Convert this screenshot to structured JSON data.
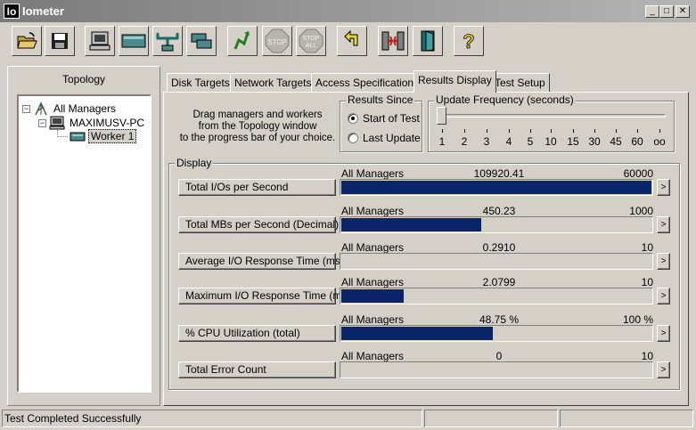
{
  "window": {
    "title": "Iometer",
    "icon_text": "Io",
    "minimize": "_",
    "maximize": "□",
    "close": "✕"
  },
  "toolbar": {
    "buttons": [
      {
        "icon": "open-folder-icon"
      },
      {
        "icon": "save-disk-icon"
      },
      {
        "icon": "new-manager-icon"
      },
      {
        "icon": "new-disk-worker-icon"
      },
      {
        "icon": "new-network-worker-icon"
      },
      {
        "icon": "duplicate-worker-icon"
      },
      {
        "icon": "start-tests-icon"
      },
      {
        "icon": "stop-icon",
        "label": "STOP"
      },
      {
        "icon": "stop-all-icon",
        "label1": "STOP",
        "label2": "ALL"
      },
      {
        "icon": "reset-workers-icon"
      },
      {
        "icon": "disconnect-workers-icon"
      },
      {
        "icon": "exit-icon"
      },
      {
        "icon": "help-icon",
        "label": "?"
      }
    ]
  },
  "topology": {
    "title": "Topology",
    "items": [
      {
        "label": "All Managers",
        "icon": "all-managers-icon",
        "expander": "−"
      },
      {
        "label": "MAXIMUSV-PC",
        "icon": "computer-icon",
        "expander": "−"
      },
      {
        "label": "Worker 1",
        "icon": "worker-disk-icon"
      }
    ]
  },
  "tabs": [
    {
      "label": "Disk Targets"
    },
    {
      "label": "Network Targets"
    },
    {
      "label": "Access Specifications"
    },
    {
      "label": "Results Display",
      "active": true
    },
    {
      "label": "Test Setup"
    }
  ],
  "instructions": [
    "Drag managers and workers",
    "from the Topology window",
    "to the progress bar of your choice."
  ],
  "results_since": {
    "title": "Results Since",
    "options": [
      {
        "label": "Start of Test",
        "selected": true
      },
      {
        "label": "Last Update",
        "selected": false
      }
    ]
  },
  "update_frequency": {
    "title": "Update Frequency (seconds)",
    "ticks": [
      "1",
      "2",
      "3",
      "4",
      "5",
      "10",
      "15",
      "30",
      "45",
      "60",
      "oo"
    ],
    "selected": "1"
  },
  "display": {
    "title": "Display",
    "rows": [
      {
        "metric": "Total I/Os per Second",
        "source": "All Managers",
        "value": "109920.41",
        "max": "60000",
        "fill": 1.0
      },
      {
        "metric": "Total MBs per Second (Decimal)",
        "source": "All Managers",
        "value": "450.23",
        "max": "1000",
        "fill": 0.45
      },
      {
        "metric": "Average I/O Response Time (ms)",
        "source": "All Managers",
        "value": "0.2910",
        "max": "10",
        "fill": 0.0
      },
      {
        "metric": "Maximum I/O Response Time (ms)",
        "source": "All Managers",
        "value": "2.0799",
        "max": "10",
        "fill": 0.2
      },
      {
        "metric": "% CPU Utilization (total)",
        "source": "All Managers",
        "value": "48.75 %",
        "max": "100 %",
        "fill": 0.4875
      },
      {
        "metric": "Total Error Count",
        "source": "All Managers",
        "value": "0",
        "max": "10",
        "fill": 0.0
      }
    ],
    "more_label": ">"
  },
  "status": {
    "text": "Test Completed Successfully"
  },
  "colors": {
    "bar_fill": "#0a246a",
    "face": "#d4d0c8"
  }
}
